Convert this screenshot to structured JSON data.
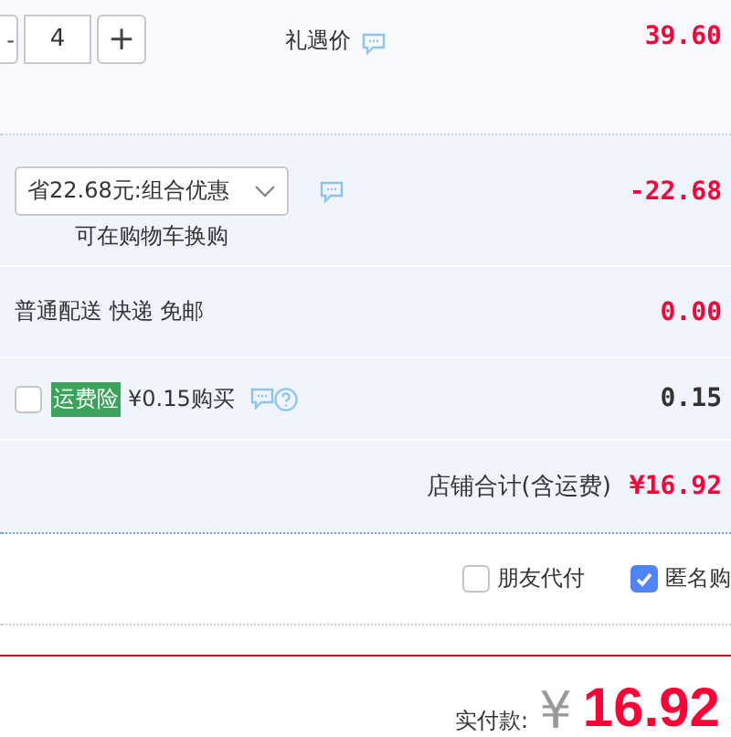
{
  "item": {
    "quantity_minus": "-",
    "quantity": "4",
    "quantity_plus": "+",
    "price_label": "礼遇价",
    "price": "39.60"
  },
  "promotion": {
    "select": "省22.68元:组合优惠",
    "note": "可在购物车换购",
    "amount": "-22.68"
  },
  "delivery": {
    "label": "普通配送 快递 免邮",
    "amount": "0.00"
  },
  "insurance": {
    "checked": false,
    "tag": "运费险",
    "label": "¥0.15购买",
    "amount": "0.15"
  },
  "store_total": {
    "label": "店铺合计(含运费)",
    "amount": "¥16.92"
  },
  "options": [
    {
      "label": "朋友代付",
      "checked": false
    },
    {
      "label": "匿名购",
      "checked": true
    }
  ],
  "payment": {
    "label": "实付款:",
    "currency": "¥",
    "amount": "16.92"
  }
}
